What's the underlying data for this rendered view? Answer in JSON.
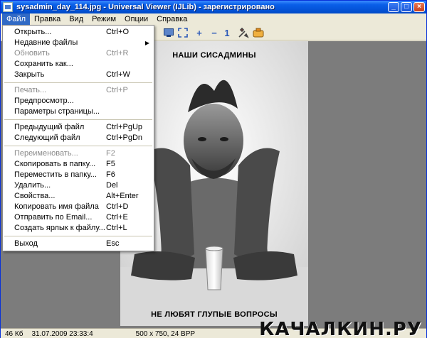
{
  "window": {
    "title": "sysadmin_day_114.jpg - Universal Viewer (IJLib) - зарегистрировано",
    "minimize": "_",
    "maximize": "□",
    "close": "×"
  },
  "menubar": [
    "Файл",
    "Правка",
    "Вид",
    "Режим",
    "Опции",
    "Справка"
  ],
  "file_menu": {
    "items": [
      {
        "label": "Открыть...",
        "shortcut": "Ctrl+O"
      },
      {
        "label": "Недавние файлы",
        "shortcut": "",
        "submenu": "▶"
      },
      {
        "label": "Обновить",
        "shortcut": "Ctrl+R",
        "disabled": true
      },
      {
        "label": "Сохранить как...",
        "shortcut": ""
      },
      {
        "label": "Закрыть",
        "shortcut": "Ctrl+W"
      },
      {
        "sep": true
      },
      {
        "label": "Печать...",
        "shortcut": "Ctrl+P",
        "disabled": true
      },
      {
        "label": "Предпросмотр...",
        "shortcut": ""
      },
      {
        "label": "Параметры страницы...",
        "shortcut": ""
      },
      {
        "sep": true
      },
      {
        "label": "Предыдущий файл",
        "shortcut": "Ctrl+PgUp"
      },
      {
        "label": "Следующий файл",
        "shortcut": "Ctrl+PgDn"
      },
      {
        "sep": true
      },
      {
        "label": "Переименовать...",
        "shortcut": "F2",
        "disabled": true
      },
      {
        "label": "Скопировать в папку...",
        "shortcut": "F5"
      },
      {
        "label": "Переместить в папку...",
        "shortcut": "F6"
      },
      {
        "label": "Удалить...",
        "shortcut": "Del"
      },
      {
        "label": "Свойства...",
        "shortcut": "Alt+Enter"
      },
      {
        "label": "Копировать имя файла",
        "shortcut": "Ctrl+D"
      },
      {
        "label": "Отправить по Email...",
        "shortcut": "Ctrl+E"
      },
      {
        "label": "Создать ярлык к файлу...",
        "shortcut": "Ctrl+L"
      },
      {
        "sep": true
      },
      {
        "label": "Выход",
        "shortcut": "Esc"
      }
    ]
  },
  "toolbar": {
    "zoom_in": "+",
    "zoom_out": "−",
    "actual_size": "1"
  },
  "photo": {
    "top_caption": "НАШИ СИСАДМИНЫ",
    "bottom_caption": "НЕ ЛЮБЯТ ГЛУПЫЕ ВОПРОСЫ"
  },
  "statusbar": {
    "filesize": "46 Кб",
    "date": "31.07.2009 23:33:4",
    "dimensions": "500 x 750, 24 BPP"
  },
  "watermark": "КАЧАЛКИН.РУ"
}
